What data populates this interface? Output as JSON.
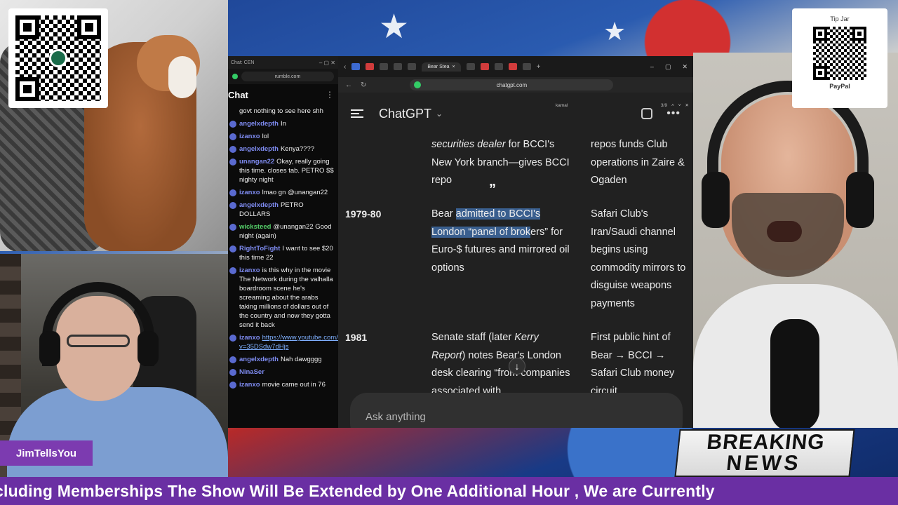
{
  "overlay": {
    "tip_jar_title": "Tip Jar",
    "tip_jar_provider": "PayPal",
    "host_name_tag": "JimTellsYou",
    "breaking_line1": "BREAKING",
    "breaking_line2": "NEWS",
    "ticker": "cluding Memberships The Show Will Be Extended by One Additional Hour , We are Currently"
  },
  "chat_window": {
    "tab_label": "Chat: CEN",
    "url": "rumble.com",
    "title": "Chat",
    "messages": [
      {
        "user": "",
        "text": "govt nothing to see here shh",
        "user_color": "blue"
      },
      {
        "user": "angelxdepth",
        "text": "In",
        "user_color": "blue"
      },
      {
        "user": "izanxo",
        "text": "lol",
        "user_color": "blue"
      },
      {
        "user": "angelxdepth",
        "text": "Kenya????",
        "user_color": "blue"
      },
      {
        "user": "unangan22",
        "text": "Okay, really going this time. closes tab. PETRO $$ nighty night",
        "user_color": "blue"
      },
      {
        "user": "izanxo",
        "text": "lmao gn @unangan22",
        "user_color": "blue"
      },
      {
        "user": "angelxdepth",
        "text": "PETRO DOLLARS",
        "user_color": "blue"
      },
      {
        "user": "wicksteed",
        "text": "@unangan22 Good night (again)",
        "user_color": "green"
      },
      {
        "user": "RightToFight",
        "text": "I want to see $20 this time 22",
        "user_color": "blue"
      },
      {
        "user": "izanxo",
        "text": "is this why in the movie The Network during the valhalla boardroom scene he's screaming about the arabs taking millions of dollars out of the country and now they gotta send it back",
        "user_color": "blue"
      },
      {
        "user": "izanxo",
        "text": "https://www.youtube.com/watch?v=35DSdw7dHjs",
        "user_color": "blue",
        "is_link": true
      },
      {
        "user": "angelxdepth",
        "text": "Nah dawgggg",
        "user_color": "blue"
      },
      {
        "user": "NinaSer",
        "text": "",
        "user_color": "blue"
      },
      {
        "user": "izanxo",
        "text": "movie came out in 76",
        "user_color": "blue"
      }
    ]
  },
  "gpt_window": {
    "tab_label": "Bear Stea",
    "url": "chatgpt.com",
    "find_query": "kamal",
    "find_count": "3/9",
    "brand": "ChatGPT",
    "input_placeholder": "Ask anything",
    "rows": [
      {
        "year": "",
        "mid_italic": "securities dealer",
        "mid": " for BCCI's New York branch—gives BCCI repo",
        "right": "repos funds Club operations in Zaire & Ogaden"
      },
      {
        "year": "1979-80",
        "mid_pre": "Bear ",
        "mid_hl": "admitted to BCCI's London “panel of brok",
        "mid_post": "ers” for Euro-$ futures and mirrored oil options",
        "right": "Safari Club's Iran/Saudi channel begins using commodity mirrors to disguise weapons payments"
      },
      {
        "year": "1981",
        "mid_pre": "Senate staff (later ",
        "mid_italic": "Kerry Report",
        "mid_post": ") notes Bear's London desk clearing “from companies associated with",
        "right": "First public hint of Bear → BCCI → Safari Club money circuit"
      }
    ]
  }
}
